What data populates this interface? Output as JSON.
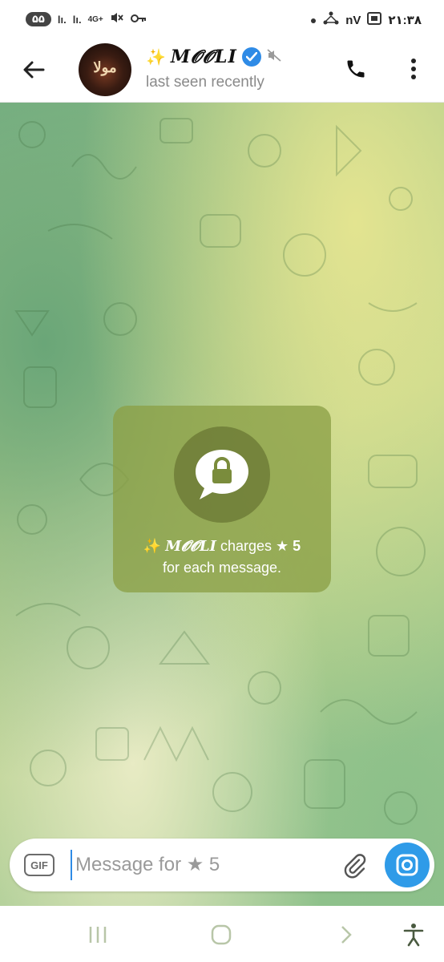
{
  "status_bar": {
    "pill": "۵۵",
    "signal1": "lı.",
    "signal2": "lı.",
    "network": "4G+",
    "time": "۲۱:۳۸",
    "extra": "nV"
  },
  "header": {
    "sparkle": "✨",
    "title": "M𝓞𝓞LI",
    "subtitle": "last seen recently",
    "avatar_text": "مولا"
  },
  "card": {
    "sparkle": "✨",
    "name": "M𝓞𝓞LI",
    "charges": "charges",
    "star": "★",
    "amount": "5",
    "line2": "for each message."
  },
  "composer": {
    "gif_label": "GIF",
    "placeholder": "Message for ★ 5"
  },
  "colors": {
    "accent": "#2f9be8",
    "verified": "#2f8be6",
    "card_bg": "#8ca046"
  },
  "icons": [
    "back-arrow-icon",
    "verified-icon",
    "mute-icon",
    "phone-icon",
    "more-vert-icon",
    "lock-bubble-icon",
    "attach-icon",
    "camera-icon",
    "recents-icon",
    "home-icon",
    "back-nav-icon",
    "accessibility-icon"
  ]
}
